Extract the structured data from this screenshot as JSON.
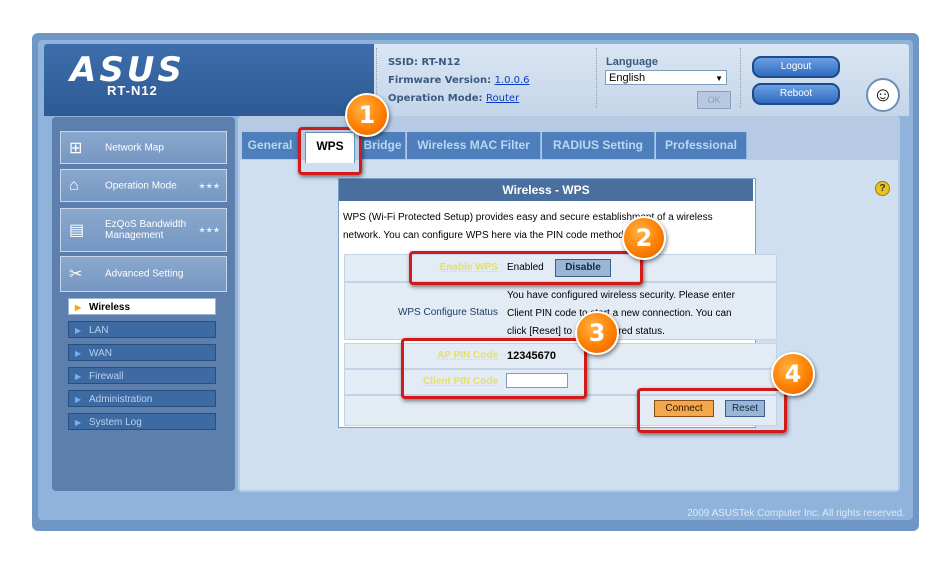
{
  "header": {
    "logo": "ASUS",
    "model": "RT-N12",
    "ssid_label": "SSID:",
    "ssid_value": "RT-N12",
    "firmware_label": "Firmware Version:",
    "firmware_value": "1.0.0.6",
    "mode_label": "Operation Mode:",
    "mode_value": "Router",
    "language_label": "Language",
    "language_value": "English",
    "ok_label": "OK",
    "logout_label": "Logout",
    "reboot_label": "Reboot"
  },
  "sidebar": {
    "items": [
      {
        "label": "Network Map"
      },
      {
        "label": "Operation Mode"
      },
      {
        "label": "EzQoS Bandwidth Management"
      },
      {
        "label": "Advanced Setting"
      }
    ],
    "subitems": [
      {
        "label": "Wireless",
        "active": true
      },
      {
        "label": "LAN"
      },
      {
        "label": "WAN"
      },
      {
        "label": "Firewall"
      },
      {
        "label": "Administration"
      },
      {
        "label": "System Log"
      }
    ]
  },
  "tabs": [
    {
      "label": "General"
    },
    {
      "label": "WPS",
      "active": true
    },
    {
      "label": "Bridge"
    },
    {
      "label": "Wireless MAC Filter"
    },
    {
      "label": "RADIUS Setting"
    },
    {
      "label": "Professional"
    }
  ],
  "panel": {
    "title": "Wireless - WPS",
    "desc_line1": "WPS (Wi-Fi Protected Setup) provides easy and secure establishment of a wireless",
    "desc_line2": "network. You can configure WPS here via the PIN code method.",
    "enable_label": "Enable WPS",
    "enable_value": "Enabled",
    "disable_button": "Disable",
    "status_label": "WPS Configure Status",
    "status_line1": "You have configured wireless security. Please enter",
    "status_line2": "Client PIN code to start a new connection. You can",
    "status_line3": "click [Reset] to unconfigured status.",
    "ap_pin_label": "AP PIN Code",
    "ap_pin_value": "12345670",
    "client_pin_label": "Client PIN Code",
    "client_pin_value": "",
    "connect_button": "Connect",
    "reset_button": "Reset"
  },
  "badges": [
    "1",
    "2",
    "3",
    "4"
  ],
  "help_icon": "?",
  "footer": "2009 ASUSTek Computer Inc. All rights reserved.",
  "colors": {
    "accent_red": "#d21a1a",
    "badge_orange": "#ff7f00",
    "header_blue": "#2d5a94"
  }
}
